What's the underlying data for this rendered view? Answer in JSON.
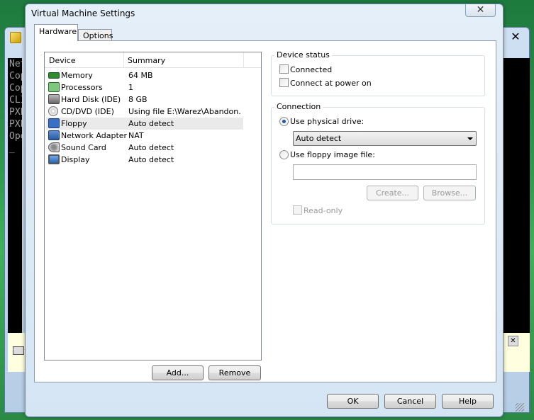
{
  "background_console": {
    "lines": [
      "Net",
      "Cop",
      "Cop",
      "",
      "CLI",
      "PXE",
      "",
      "PXE",
      "Ope",
      "_"
    ]
  },
  "dialog": {
    "title": "Virtual Machine Settings",
    "close_glyph": "✕"
  },
  "tabs": [
    {
      "label": "Hardware",
      "active": true
    },
    {
      "label": "Options",
      "active": false
    }
  ],
  "device_list": {
    "columns": [
      "Device",
      "Summary"
    ],
    "rows": [
      {
        "device": "Memory",
        "summary": "64 MB",
        "icon": "memory-icon",
        "selected": false
      },
      {
        "device": "Processors",
        "summary": "1",
        "icon": "processor-icon",
        "selected": false
      },
      {
        "device": "Hard Disk (IDE)",
        "summary": "8 GB",
        "icon": "hard-disk-icon",
        "selected": false
      },
      {
        "device": "CD/DVD (IDE)",
        "summary": "Using file E:\\Warez\\Abandon...",
        "icon": "cd-dvd-icon",
        "selected": false
      },
      {
        "device": "Floppy",
        "summary": "Auto detect",
        "icon": "floppy-icon",
        "selected": true
      },
      {
        "device": "Network Adapter",
        "summary": "NAT",
        "icon": "network-adapter-icon",
        "selected": false
      },
      {
        "device": "Sound Card",
        "summary": "Auto detect",
        "icon": "sound-card-icon",
        "selected": false
      },
      {
        "device": "Display",
        "summary": "Auto detect",
        "icon": "display-icon",
        "selected": false
      }
    ],
    "add_label": "Add...",
    "remove_label": "Remove"
  },
  "device_status": {
    "title": "Device status",
    "connected_label": "Connected",
    "connected_checked": false,
    "connect_power_label": "Connect at power on",
    "connect_power_checked": false
  },
  "connection": {
    "title": "Connection",
    "physical_label": "Use physical drive:",
    "physical_selected": true,
    "drive_value": "Auto detect",
    "image_label": "Use floppy image file:",
    "image_value": "",
    "create_label": "Create...",
    "browse_label": "Browse...",
    "readonly_label": "Read-only"
  },
  "footer": {
    "ok_label": "OK",
    "cancel_label": "Cancel",
    "help_label": "Help"
  },
  "background_window": {
    "close_glyph": "✕",
    "bar_close_glyph": "✕"
  }
}
